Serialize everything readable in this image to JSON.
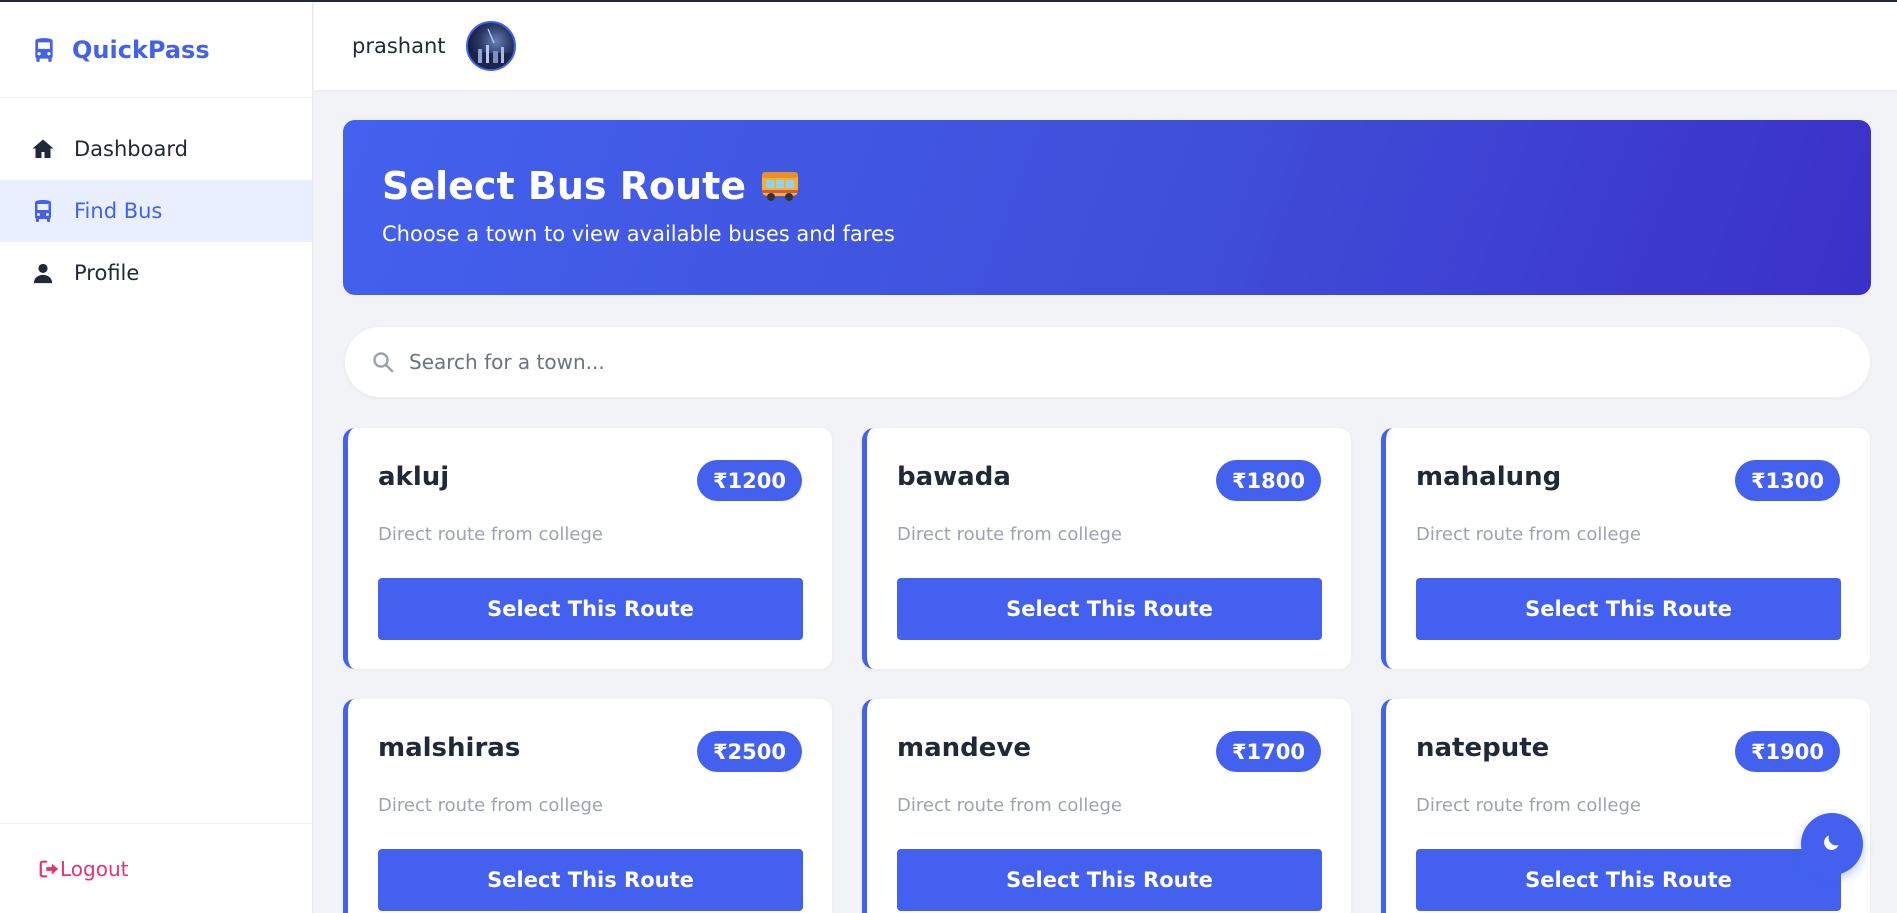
{
  "app": {
    "name": "QuickPass",
    "brand_icon": "bus-icon",
    "accent_color": "#4361ee"
  },
  "sidebar": {
    "items": [
      {
        "label": "Dashboard",
        "icon": "home-icon",
        "active": false
      },
      {
        "label": "Find Bus",
        "icon": "bus-icon",
        "active": true
      },
      {
        "label": "Profile",
        "icon": "user-icon",
        "active": false
      }
    ],
    "logout_label": "Logout",
    "logout_color": "#e8336d"
  },
  "header": {
    "username": "prashant"
  },
  "banner": {
    "title": "Select Bus Route",
    "emoji": "bus-emoji",
    "subtitle": "Choose a town to view available buses and fares"
  },
  "search": {
    "placeholder": "Search for a town...",
    "value": ""
  },
  "routes": [
    {
      "town": "akluj",
      "fare": "₹1200",
      "description": "Direct route from college",
      "button": "Select This Route"
    },
    {
      "town": "bawada",
      "fare": "₹1800",
      "description": "Direct route from college",
      "button": "Select This Route"
    },
    {
      "town": "mahalung",
      "fare": "₹1300",
      "description": "Direct route from college",
      "button": "Select This Route"
    },
    {
      "town": "malshiras",
      "fare": "₹2500",
      "description": "Direct route from college",
      "button": "Select This Route"
    },
    {
      "town": "mandeve",
      "fare": "₹1700",
      "description": "Direct route from college",
      "button": "Select This Route"
    },
    {
      "town": "natepute",
      "fare": "₹1900",
      "description": "Direct route from college",
      "button": "Select This Route"
    }
  ],
  "theme_toggle_icon": "moon-icon"
}
